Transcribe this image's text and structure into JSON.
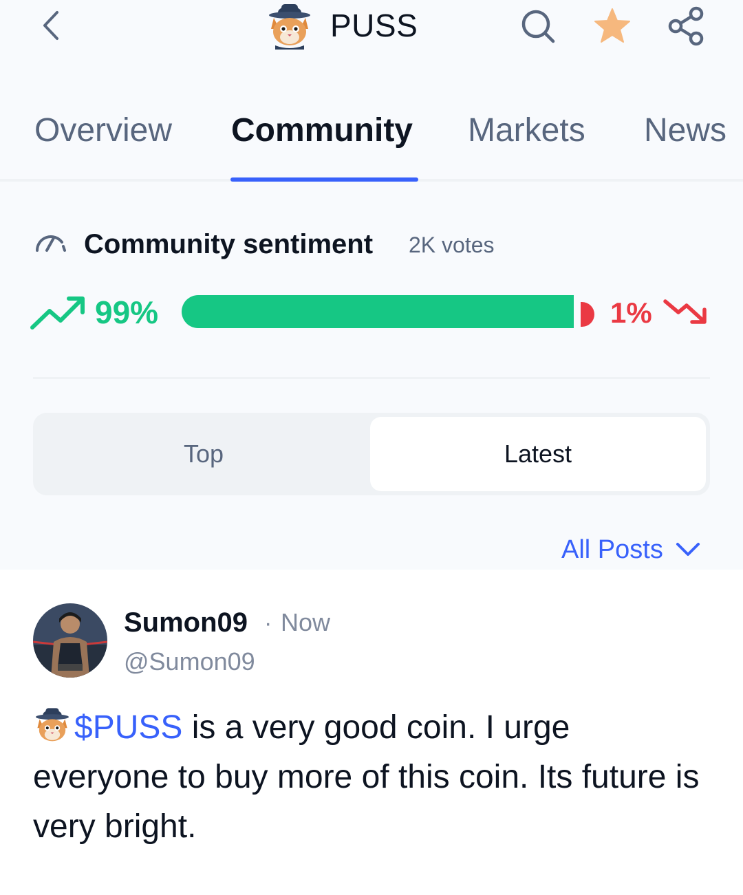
{
  "header": {
    "back_icon": "chevron-left-icon",
    "coin_symbol": "PUSS",
    "coin_logo_icon": "puss-cat-logo",
    "search_icon": "search-icon",
    "favorite_icon": "star-icon",
    "favorite_color": "#f6b87e",
    "share_icon": "share-icon"
  },
  "tabs": [
    {
      "label": "Overview",
      "active": false
    },
    {
      "label": "Community",
      "active": true
    },
    {
      "label": "Markets",
      "active": false
    },
    {
      "label": "News",
      "active": false
    }
  ],
  "sentiment": {
    "icon": "gauge-icon",
    "title": "Community sentiment",
    "votes": "2K votes",
    "bullish_pct": "99%",
    "bearish_pct": "1%",
    "bullish_fraction": 0.99,
    "bullish_color": "#16c784",
    "bearish_color": "#ea3943",
    "up_icon": "trend-up-icon",
    "down_icon": "trend-down-icon"
  },
  "feed_toggle": {
    "options": [
      "Top",
      "Latest"
    ],
    "selected": "Latest"
  },
  "filter": {
    "label": "All Posts",
    "icon": "chevron-down-icon"
  },
  "post": {
    "author": "Sumon09",
    "dot": "·",
    "time": "Now",
    "handle": "@Sumon09",
    "cashtag": "$PUSS",
    "text": " is a very good coin. I urge everyone to buy more of this coin. Its future is very bright."
  },
  "colors": {
    "accent": "#3861fb",
    "text_primary": "#0d1421",
    "text_secondary": "#58667e"
  }
}
